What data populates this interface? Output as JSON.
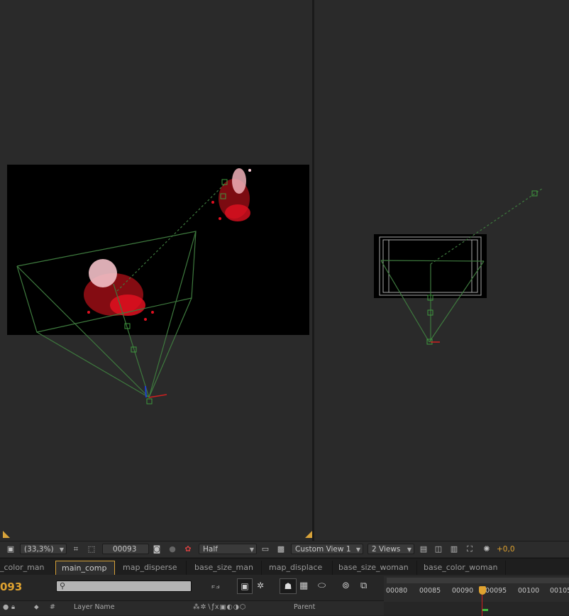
{
  "toolbar": {
    "zoom": "(33,3%)",
    "frame": "00093",
    "resolution": "Half",
    "view": "Custom View 1",
    "views_layout": "2 Views",
    "exposure": "+0,0"
  },
  "tabs": [
    {
      "label": "_color_man",
      "active": false
    },
    {
      "label": "main_comp",
      "active": true
    },
    {
      "label": "map_disperse",
      "active": false
    },
    {
      "label": "base_size_man",
      "active": false
    },
    {
      "label": "map_displace",
      "active": false
    },
    {
      "label": "base_size_woman",
      "active": false
    },
    {
      "label": "base_color_woman",
      "active": false
    }
  ],
  "timeline": {
    "current_time": "093",
    "ruler_labels": [
      "00080",
      "00085",
      "00090",
      "00095",
      "00100",
      "00105"
    ],
    "columns": {
      "number": "#",
      "layer_name": "Layer Name",
      "parent": "Parent"
    }
  },
  "colors": {
    "accent": "#e0a330",
    "camera_wire": "#3e7a3e",
    "particles": "#d01020"
  }
}
